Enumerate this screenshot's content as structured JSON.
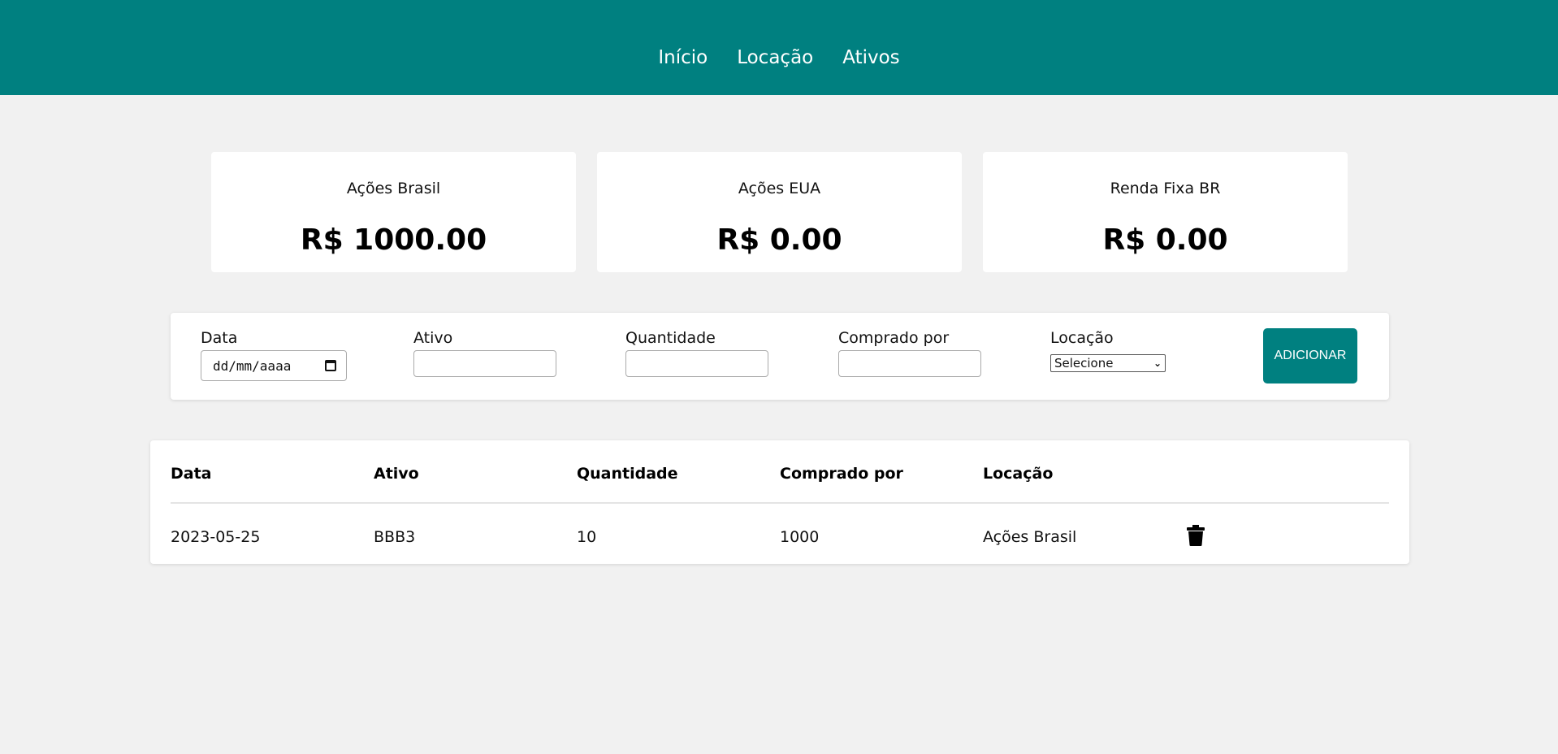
{
  "nav": {
    "items": [
      "Início",
      "Locação",
      "Ativos"
    ]
  },
  "cards": [
    {
      "title": "Ações Brasil",
      "value": "R$ 1000.00"
    },
    {
      "title": "Ações EUA",
      "value": "R$ 0.00"
    },
    {
      "title": "Renda Fixa BR",
      "value": "R$ 0.00"
    }
  ],
  "form": {
    "date_label": "Data",
    "date_placeholder": "dd/mm/aaaa",
    "ativo_label": "Ativo",
    "quantidade_label": "Quantidade",
    "comprado_label": "Comprado por",
    "locacao_label": "Locação",
    "locacao_selected": "Selecione",
    "add_label": "ADICIONAR"
  },
  "table": {
    "headers": [
      "Data",
      "Ativo",
      "Quantidade",
      "Comprado por",
      "Locação"
    ],
    "rows": [
      [
        "2023-05-25",
        "BBB3",
        "10",
        "1000",
        "Ações Brasil"
      ]
    ]
  },
  "colors": {
    "accent": "#008080",
    "background": "#f1f1f1"
  },
  "icons": {
    "delete": "trash-icon",
    "calendar": "calendar-icon",
    "select": "chevron-down-icon"
  }
}
